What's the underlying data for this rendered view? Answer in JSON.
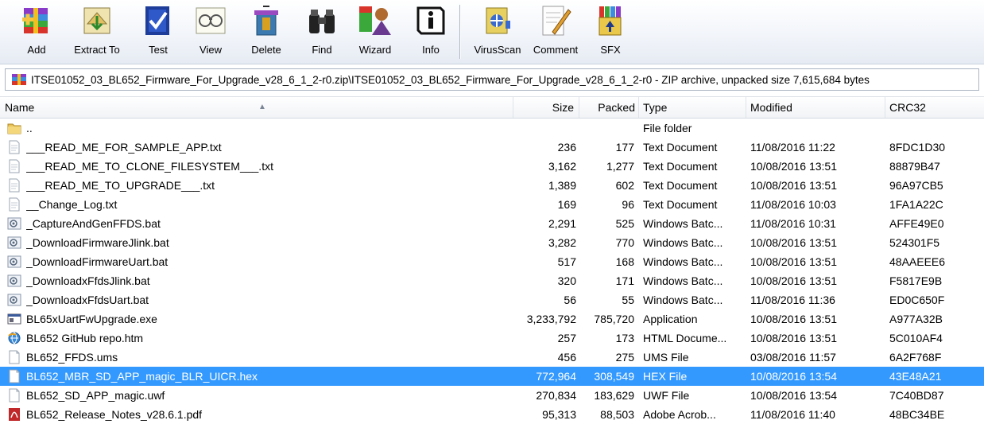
{
  "toolbar": {
    "buttons": [
      {
        "label": "Add",
        "icon": "add-archive-icon"
      },
      {
        "label": "Extract To",
        "icon": "extract-to-icon"
      },
      {
        "label": "Test",
        "icon": "test-icon"
      },
      {
        "label": "View",
        "icon": "view-icon"
      },
      {
        "label": "Delete",
        "icon": "delete-icon"
      },
      {
        "label": "Find",
        "icon": "find-binoculars-icon"
      },
      {
        "label": "Wizard",
        "icon": "wizard-icon"
      },
      {
        "label": "Info",
        "icon": "info-icon"
      },
      {
        "label": "VirusScan",
        "icon": "virus-scan-icon"
      },
      {
        "label": "Comment",
        "icon": "comment-icon"
      },
      {
        "label": "SFX",
        "icon": "sfx-icon"
      }
    ]
  },
  "path": {
    "text": "ITSE01052_03_BL652_Firmware_For_Upgrade_v28_6_1_2-r0.zip\\ITSE01052_03_BL652_Firmware_For_Upgrade_v28_6_1_2-r0 - ZIP archive, unpacked size 7,615,684 bytes"
  },
  "columns": {
    "name": "Name",
    "size": "Size",
    "packed": "Packed",
    "type": "Type",
    "modified": "Modified",
    "crc": "CRC32"
  },
  "colors": {
    "selection": "#3399ff",
    "toolbar_top": "#ffffff",
    "toolbar_bottom": "#e6ebf3"
  },
  "files": [
    {
      "name": "..",
      "size": "",
      "packed": "",
      "type": "File folder",
      "modified": "",
      "crc": "",
      "icon": "folder-up-icon"
    },
    {
      "name": "___READ_ME_FOR_SAMPLE_APP.txt",
      "size": "236",
      "packed": "177",
      "type": "Text Document",
      "modified": "11/08/2016 11:22",
      "crc": "8FDC1D30",
      "icon": "text-file-icon"
    },
    {
      "name": "___READ_ME_TO_CLONE_FILESYSTEM___.txt",
      "size": "3,162",
      "packed": "1,277",
      "type": "Text Document",
      "modified": "10/08/2016 13:51",
      "crc": "88879B47",
      "icon": "text-file-icon"
    },
    {
      "name": "___READ_ME_TO_UPGRADE___.txt",
      "size": "1,389",
      "packed": "602",
      "type": "Text Document",
      "modified": "10/08/2016 13:51",
      "crc": "96A97CB5",
      "icon": "text-file-icon"
    },
    {
      "name": "__Change_Log.txt",
      "size": "169",
      "packed": "96",
      "type": "Text Document",
      "modified": "11/08/2016 10:03",
      "crc": "1FA1A22C",
      "icon": "text-file-icon"
    },
    {
      "name": "_CaptureAndGenFFDS.bat",
      "size": "2,291",
      "packed": "525",
      "type": "Windows Batc...",
      "modified": "11/08/2016 10:31",
      "crc": "AFFE49E0",
      "icon": "batch-file-icon"
    },
    {
      "name": "_DownloadFirmwareJlink.bat",
      "size": "3,282",
      "packed": "770",
      "type": "Windows Batc...",
      "modified": "10/08/2016 13:51",
      "crc": "524301F5",
      "icon": "batch-file-icon"
    },
    {
      "name": "_DownloadFirmwareUart.bat",
      "size": "517",
      "packed": "168",
      "type": "Windows Batc...",
      "modified": "10/08/2016 13:51",
      "crc": "48AAEEE6",
      "icon": "batch-file-icon"
    },
    {
      "name": "_DownloadxFfdsJlink.bat",
      "size": "320",
      "packed": "171",
      "type": "Windows Batc...",
      "modified": "10/08/2016 13:51",
      "crc": "F5817E9B",
      "icon": "batch-file-icon"
    },
    {
      "name": "_DownloadxFfdsUart.bat",
      "size": "56",
      "packed": "55",
      "type": "Windows Batc...",
      "modified": "11/08/2016 11:36",
      "crc": "ED0C650F",
      "icon": "batch-file-icon"
    },
    {
      "name": "BL65xUartFwUpgrade.exe",
      "size": "3,233,792",
      "packed": "785,720",
      "type": "Application",
      "modified": "10/08/2016 13:51",
      "crc": "A977A32B",
      "icon": "application-icon"
    },
    {
      "name": "BL652 GitHub repo.htm",
      "size": "257",
      "packed": "173",
      "type": "HTML Docume...",
      "modified": "10/08/2016 13:51",
      "crc": "5C010AF4",
      "icon": "html-file-icon"
    },
    {
      "name": "BL652_FFDS.ums",
      "size": "456",
      "packed": "275",
      "type": "UMS File",
      "modified": "03/08/2016 11:57",
      "crc": "6A2F768F",
      "icon": "generic-file-icon"
    },
    {
      "name": "BL652_MBR_SD_APP_magic_BLR_UICR.hex",
      "size": "772,964",
      "packed": "308,549",
      "type": "HEX File",
      "modified": "10/08/2016 13:54",
      "crc": "43E48A21",
      "icon": "generic-file-icon",
      "selected": true
    },
    {
      "name": "BL652_SD_APP_magic.uwf",
      "size": "270,834",
      "packed": "183,629",
      "type": "UWF File",
      "modified": "10/08/2016 13:54",
      "crc": "7C40BD87",
      "icon": "generic-file-icon"
    },
    {
      "name": "BL652_Release_Notes_v28.6.1.pdf",
      "size": "95,313",
      "packed": "88,503",
      "type": "Adobe Acrob...",
      "modified": "11/08/2016 11:40",
      "crc": "48BC34BE",
      "icon": "pdf-file-icon"
    }
  ]
}
